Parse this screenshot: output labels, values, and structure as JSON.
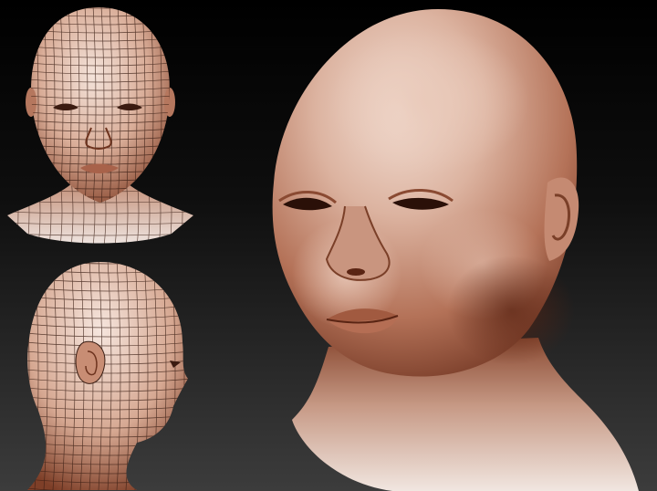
{
  "scene": {
    "background_top": "#000000",
    "background_bottom": "#3c3c3c",
    "clay_highlight": "#f2ddd2",
    "clay_mid": "#d5a892",
    "clay_shadow": "#7a3f28",
    "wire_color": "#3a1e14"
  },
  "views": [
    {
      "id": "front-wireframe",
      "kind": "wireframe front view of sculpted head"
    },
    {
      "id": "side-wireframe",
      "kind": "wireframe profile view of sculpted head"
    },
    {
      "id": "main-sculpt",
      "kind": "high-resolution sculpted baby head, three-quarter view"
    }
  ]
}
